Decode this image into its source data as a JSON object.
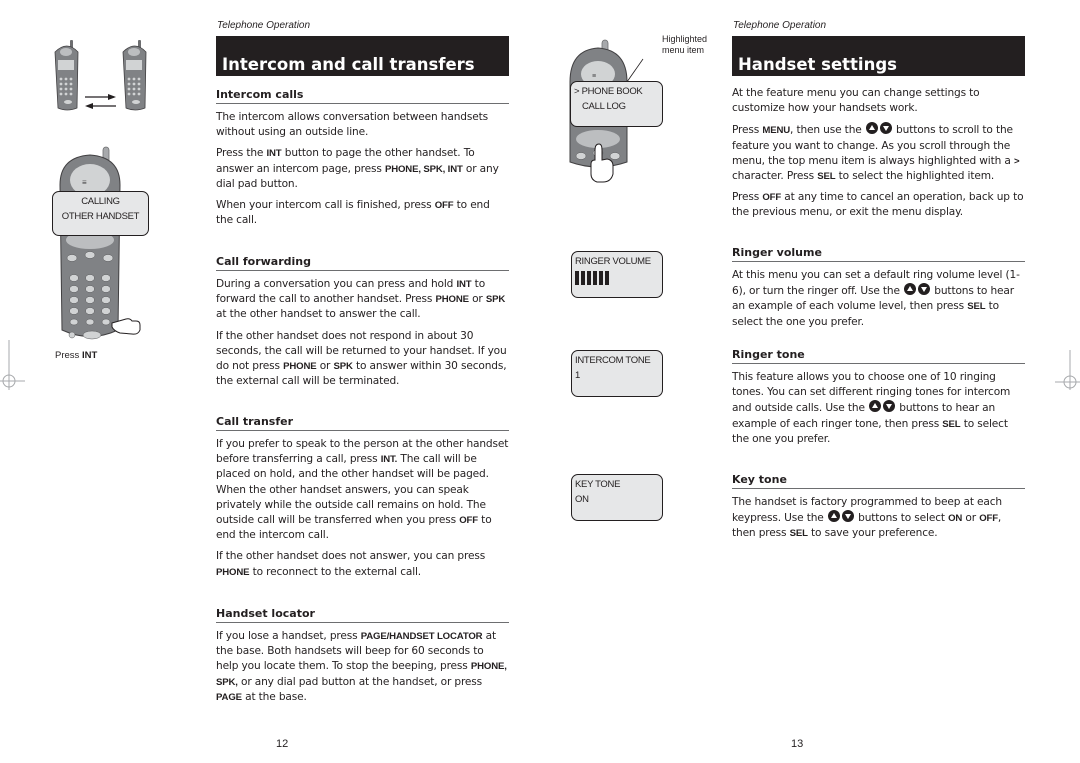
{
  "left_page": {
    "running_head": "Telephone Operation",
    "title": "Intercom and call transfers",
    "page_number": "12",
    "illustrations": {
      "calling_screen": {
        "line1": "CALLING",
        "line2": "OTHER HANDSET"
      },
      "caption_prefix": "Press",
      "caption_key": "INT"
    },
    "sections": {
      "intercom_calls": {
        "heading": "Intercom calls",
        "p1": "The intercom allows conversation between handsets without using an outside line.",
        "p2": {
          "a": "Press the ",
          "k1": "INT",
          "b": " button to page the other handset. To answer an intercom page, press ",
          "k2": "PHONE, SPK, INT",
          "c": " or any dial pad button."
        },
        "p3": {
          "a": "When your intercom call is finished, press ",
          "k1": "OFF",
          "b": " to end the call."
        }
      },
      "call_forwarding": {
        "heading": "Call forwarding",
        "p1": {
          "a": "During a conversation you can press and hold ",
          "k1": "INT",
          "b": " to forward the call to another handset. Press ",
          "k2": "PHONE",
          "c": " or ",
          "k3": "SPK",
          "d": " at the other handset to answer the call."
        },
        "p2": {
          "a": "If the other handset does not respond in about 30 seconds, the call will be returned to your handset. If you do not press ",
          "k1": "PHONE",
          "b": " or ",
          "k2": "SPK",
          "c": " to answer within 30 seconds, the external call will be terminated."
        }
      },
      "call_transfer": {
        "heading": "Call transfer",
        "p1": {
          "a": "If you prefer to speak to the person at the other handset before transferring a call, press ",
          "k1": "INT.",
          "b": " The call will be placed on hold, and the other handset will be paged. When the other handset answers, you can speak privately while the outside call remains on hold. The outside call will be transferred when you press ",
          "k2": "OFF",
          "c": " to end the intercom call."
        },
        "p2": {
          "a": "If the other handset does not answer, you can press ",
          "k1": "PHONE",
          "b": " to reconnect to the external call."
        }
      },
      "handset_locator": {
        "heading": "Handset locator",
        "p1": {
          "a": "If you lose a handset, press ",
          "k1": "PAGE/HANDSET LOCATOR",
          "b": " at the base. Both handsets will beep for 60 seconds to help you locate them. To stop the beeping, press ",
          "k2": "PHONE, SPK,",
          "c": " or any dial pad button at the handset, or press ",
          "k3": "PAGE",
          "d": " at the base."
        }
      }
    }
  },
  "right_page": {
    "running_head": "Telephone Operation",
    "title": "Handset settings",
    "page_number": "13",
    "illustrations": {
      "callout_line1": "Highlighted",
      "callout_line2": "menu item",
      "menu_screen": {
        "line1": "> PHONE BOOK",
        "line2": "CALL LOG"
      },
      "ringer_volume_screen": {
        "label": "RINGER VOLUME",
        "level": 6,
        "max_level": 6
      },
      "intercom_tone_screen": {
        "label": "INTERCOM TONE",
        "value": "1"
      },
      "key_tone_screen": {
        "label": "KEY TONE",
        "value": "ON"
      }
    },
    "intro": {
      "p1": "At the feature menu you can change settings to customize how your handsets work.",
      "p2": {
        "a": "Press ",
        "k1": "MENU",
        "b": ", then use the ",
        "c": " buttons to scroll to the feature you want to change. As you scroll through the menu, the top menu item is always highlighted with a ",
        "k2": ">",
        "d": " character. Press ",
        "k3": "SEL",
        "e": " to select the highlighted item."
      },
      "p3": {
        "a": "Press ",
        "k1": "OFF",
        "b": " at any time to cancel an operation, back up to the previous menu, or exit the menu display."
      }
    },
    "sections": {
      "ringer_volume": {
        "heading": "Ringer volume",
        "p1": {
          "a": "At this menu you can set a default ring volume level (1-6), or turn the ringer off. Use the ",
          "b": " buttons to hear an example of each volume level, then press ",
          "k1": "SEL",
          "c": " to select the one you prefer."
        }
      },
      "ringer_tone": {
        "heading": "Ringer tone",
        "p1": {
          "a": "This feature allows you to choose one of 10 ringing tones. You can set different ringing tones for intercom and outside calls. Use the ",
          "b": " buttons to hear an example of each ringer tone, then press ",
          "k1": "SEL",
          "c": " to select the one you prefer."
        }
      },
      "key_tone": {
        "heading": "Key tone",
        "p1": {
          "a": "The handset is factory programmed to beep at each keypress. Use the ",
          "b": " buttons to select ",
          "k1": "ON",
          "c": " or ",
          "k2": "OFF",
          "d": ", then press ",
          "k3": "SEL",
          "e": " to save your preference."
        }
      }
    }
  }
}
